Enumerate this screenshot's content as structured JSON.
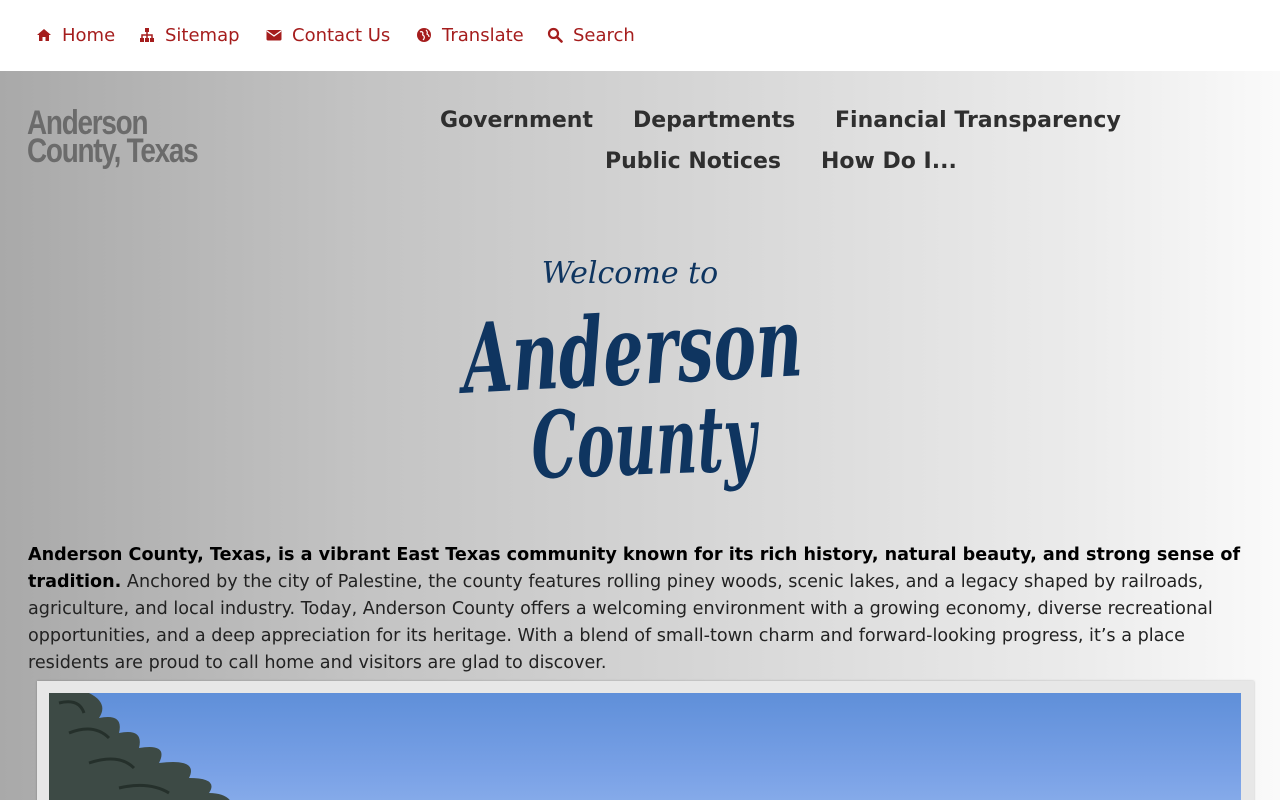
{
  "utility_nav": {
    "items": [
      {
        "label": "Home",
        "icon": "home-icon"
      },
      {
        "label": "Sitemap",
        "icon": "sitemap-icon"
      },
      {
        "label": "Contact Us",
        "icon": "envelope-icon"
      },
      {
        "label": "Translate",
        "icon": "globe-icon"
      },
      {
        "label": "Search",
        "icon": "search-icon"
      }
    ],
    "color": "#a51d1d"
  },
  "site_title": "Anderson County, Texas",
  "main_nav": {
    "items": [
      {
        "label": "Government"
      },
      {
        "label": "Departments"
      },
      {
        "label": "Financial Transparency"
      },
      {
        "label": "Public Notices"
      },
      {
        "label": "How Do I..."
      }
    ]
  },
  "welcome_logo": {
    "line1": "Welcome to",
    "line2": "Anderson",
    "line3": "County",
    "color": "#0f3560"
  },
  "intro": {
    "lead": "Anderson County, Texas, is a vibrant East Texas community known for its rich history, natural beauty, and strong sense of tradition.",
    "body": "Anchored by the city of Palestine, the county features rolling piney woods, scenic lakes, and a legacy shaped by railroads, agriculture, and local industry. Today, Anderson County offers a welcoming environment with a growing economy, diverse recreational opportunities, and a deep appreciation for its heritage. With a blend of small-town charm and forward-looking progress, it’s a place residents are proud to call home and visitors are glad to discover."
  }
}
